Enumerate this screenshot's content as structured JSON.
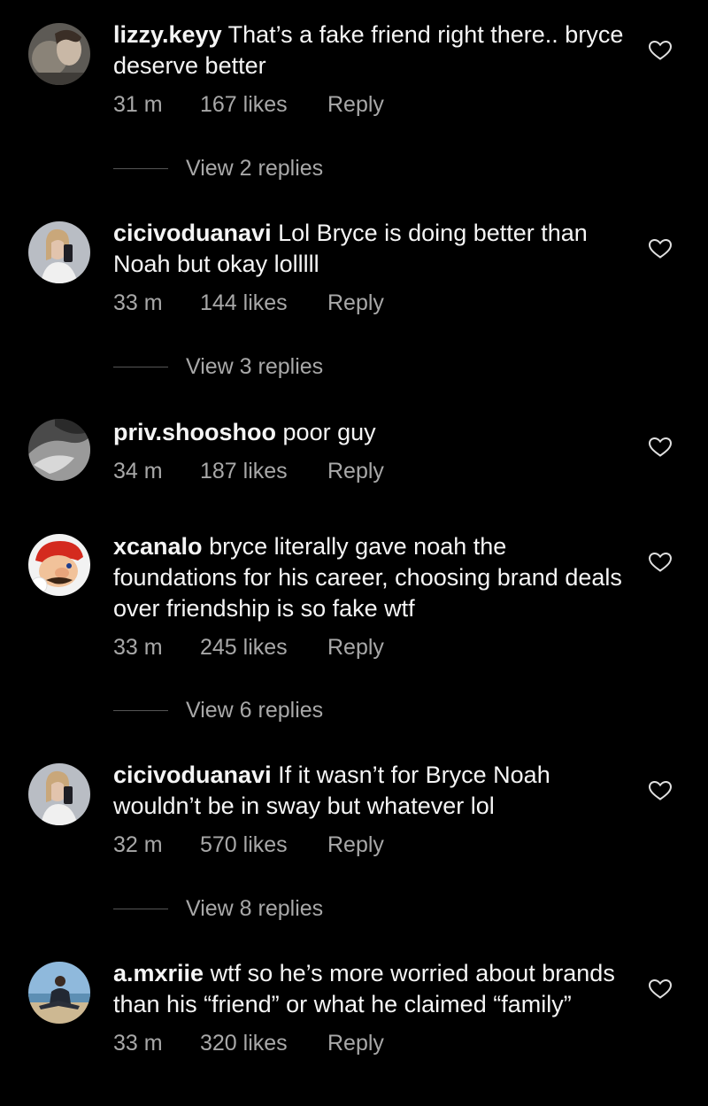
{
  "comments": [
    {
      "username": "lizzy.keyy",
      "text": "That’s a fake friend right there.. bryce deserve better",
      "time": "31 m",
      "likes": "167 likes",
      "reply_label": "Reply",
      "view_replies": "View 2 replies",
      "avatar": "avatar-photo-cat-portrait"
    },
    {
      "username": "cicivoduanavi",
      "text": "Lol Bryce is doing better than Noah but okay lolllll",
      "time": "33 m",
      "likes": "144 likes",
      "reply_label": "Reply",
      "view_replies": "View 3 replies",
      "avatar": "avatar-photo-mirror-selfie"
    },
    {
      "username": "priv.shooshoo",
      "text": "poor guy",
      "time": "34 m",
      "likes": "187 likes",
      "reply_label": "Reply",
      "avatar": "avatar-photo-grayscale"
    },
    {
      "username": "xcanalo",
      "text": "bryce literally gave noah the foundations for his career, choosing brand deals over friendship is so fake wtf",
      "time": "33 m",
      "likes": "245 likes",
      "reply_label": "Reply",
      "view_replies": "View 6 replies",
      "avatar": "avatar-photo-red-cap-character"
    },
    {
      "username": "cicivoduanavi",
      "text": "If it wasn’t for Bryce Noah wouldn’t be in sway but whatever lol",
      "time": "32 m",
      "likes": "570 likes",
      "reply_label": "Reply",
      "view_replies": "View 8 replies",
      "avatar": "avatar-photo-mirror-selfie"
    },
    {
      "username": "a.mxriie",
      "text": "wtf so he’s more worried about brands than his “friend” or what he claimed “family”",
      "time": "33 m",
      "likes": "320 likes",
      "reply_label": "Reply",
      "avatar": "avatar-photo-beach"
    }
  ],
  "icons": {
    "like": "heart-outline-icon"
  },
  "colors": {
    "background": "#000000",
    "primary_text": "#f5f5f5",
    "secondary_text": "#a8a8a8"
  }
}
